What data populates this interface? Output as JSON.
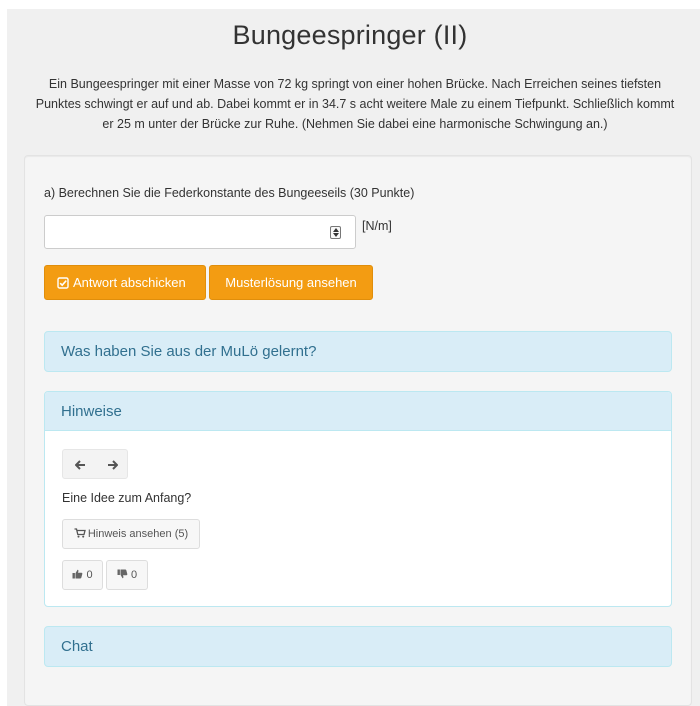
{
  "header": {
    "title": "Bungeespringer (II)",
    "intro_lines": [
      "Ein Bungeespringer mit einer Masse von 72 kg springt von einer hohen Brücke. Nach Erreichen seines tiefsten",
      "Punktes schwingt er auf und ab. Dabei kommt er in 34.7 s acht weitere Male zu einem Tiefpunkt. Schließlich kommt",
      "er 25 m unter der Brücke zur Ruhe. (Nehmen Sie dabei eine harmonische Schwingung an.)"
    ]
  },
  "task": {
    "question": "a) Berechnen Sie die Federkonstante des Bungeeseils (30 Punkte)",
    "answer_value": "",
    "unit": "[N/m]",
    "submit_label": "Antwort abschicken",
    "solution_label": "Musterlösung ansehen"
  },
  "panels": {
    "learned_title": "Was haben Sie aus der MuLö gelernt?",
    "hints_title": "Hinweise",
    "chat_title": "Chat"
  },
  "hints": {
    "intro": "Eine Idee zum Anfang?",
    "show_hint_label": "Hinweis ansehen (5)",
    "likes": "0",
    "dislikes": "0",
    "prev_icon": "arrow-left-icon",
    "next_icon": "arrow-right-icon"
  },
  "colors": {
    "accent_orange": "#f39c12",
    "panel_info_bg": "#d9edf7",
    "panel_info_text": "#31708f"
  }
}
